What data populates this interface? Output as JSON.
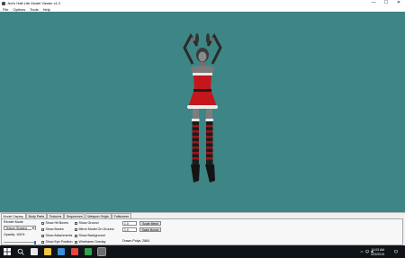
{
  "window": {
    "title": "Jed's Half-Life Model Viewer v1.2",
    "min_glyph": "—",
    "max_glyph": "☐",
    "close_glyph": "✕"
  },
  "menu": [
    "File",
    "Options",
    "Tools",
    "Help"
  ],
  "viewport": {
    "background_color": "#3e8585"
  },
  "tabs": [
    "Model Display",
    "Body Parts",
    "Textures",
    "Sequences",
    "Weapon Origin",
    "Fullscreen"
  ],
  "model_display": {
    "render_mode_label": "Render Mode",
    "render_mode_value": "Texture Shaded",
    "opacity_label": "Opacity: 100%",
    "opacity_value": 1.0,
    "checks_col1": [
      "Show Hit Boxes",
      "Show Bones",
      "Show Attachments",
      "Show Eye Position"
    ],
    "checks_col2": [
      "Show Ground",
      "Mirror Model On Ground",
      "Show Background",
      "Wireframe Overlay"
    ],
    "scale_mesh_value": "1.0",
    "scale_bones_value": "1.0",
    "scale_mesh_button": "Scale Mesh",
    "scale_bones_button": "Scale Bones",
    "drawn_polys": "Drawn Polys: 2864"
  },
  "taskbar": {
    "start_icon": "windows-logo",
    "search_icon": "search-icon",
    "apps": [
      {
        "name": "task-view",
        "color": "#e8e8e8"
      },
      {
        "name": "file-explorer",
        "color": "#f4c542"
      },
      {
        "name": "store",
        "color": "#3b8fd6"
      },
      {
        "name": "chrome",
        "color": "#e8453c"
      },
      {
        "name": "app-green",
        "color": "#2fa44f"
      },
      {
        "name": "model-viewer",
        "color": "#6d6d6d"
      }
    ],
    "time": "10:03 AM",
    "date": "4/22/2019"
  }
}
